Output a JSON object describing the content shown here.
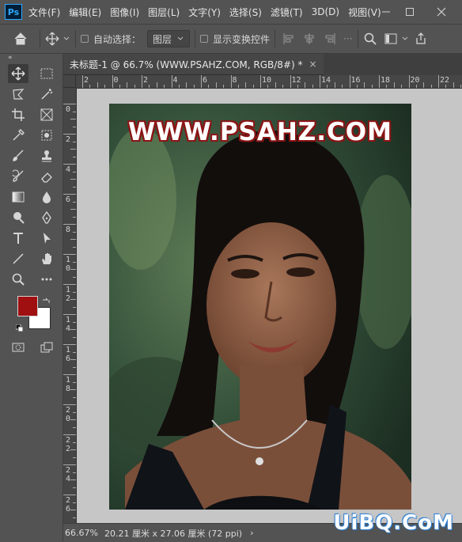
{
  "app": {
    "logo": "Ps"
  },
  "menu": [
    {
      "label": "文件(F)"
    },
    {
      "label": "编辑(E)"
    },
    {
      "label": "图像(I)"
    },
    {
      "label": "图层(L)"
    },
    {
      "label": "文字(Y)"
    },
    {
      "label": "选择(S)"
    },
    {
      "label": "滤镜(T)"
    },
    {
      "label": "3D(D)"
    },
    {
      "label": "视图(V)"
    }
  ],
  "options": {
    "auto_select_label": "自动选择：",
    "auto_select_target": "图层",
    "show_transform_label": "显示变换控件"
  },
  "toolbar": {
    "collapse": "«"
  },
  "document": {
    "tab_title": "未标题-1 @ 66.7% (WWW.PSAHZ.COM, RGB/8#) *",
    "close": "×",
    "image_text": "WWW.PSAHZ.COM"
  },
  "rulers": {
    "h_labels": [
      "2",
      "0",
      "2",
      "4",
      "6",
      "8",
      "10",
      "12",
      "14",
      "16",
      "18",
      "20",
      "22"
    ],
    "v_labels": [
      "0",
      "2",
      "4",
      "6",
      "8",
      "10",
      "12",
      "14",
      "16",
      "18",
      "20",
      "22",
      "24",
      "26"
    ]
  },
  "status": {
    "zoom": "66.67%",
    "doc_size": "20.21 厘米 x 27.06 厘米 (72 ppi)",
    "arrow": "›"
  },
  "site_watermark": "UiBQ.CoM",
  "colors": {
    "foreground": "#a01010",
    "background": "#ffffff",
    "accent": "#31a8ff"
  }
}
